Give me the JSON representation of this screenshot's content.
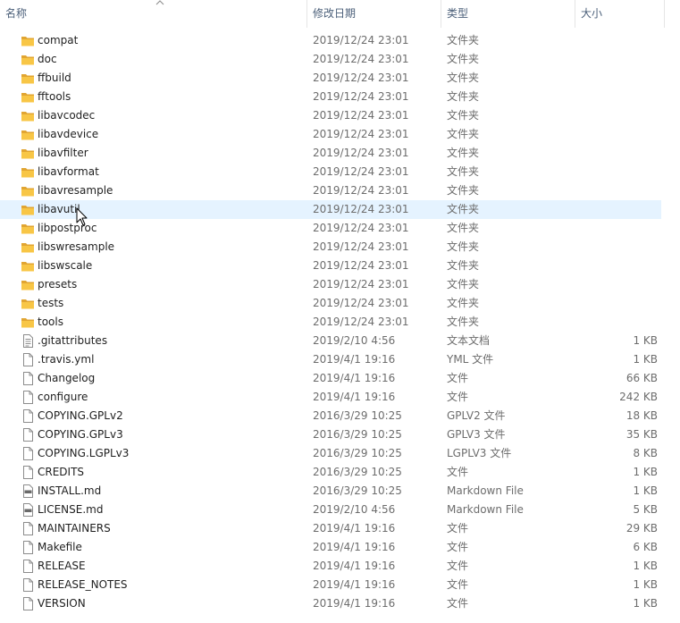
{
  "columns": {
    "name": "名称",
    "date": "修改日期",
    "type": "类型",
    "size": "大小"
  },
  "hover_row_index": 9,
  "icon_types": {
    "folder": "folder-icon",
    "file": "file-icon",
    "text": "text-document-icon",
    "markdown": "markdown-file-icon"
  },
  "colors": {
    "folder": "#f8c646",
    "folder_dark": "#e1a532",
    "hover": "#e5f3ff",
    "header_text": "#4c607a"
  },
  "files": [
    {
      "name": "compat",
      "date": "2019/12/24 23:01",
      "type": "文件夹",
      "size": "",
      "icon": "folder"
    },
    {
      "name": "doc",
      "date": "2019/12/24 23:01",
      "type": "文件夹",
      "size": "",
      "icon": "folder"
    },
    {
      "name": "ffbuild",
      "date": "2019/12/24 23:01",
      "type": "文件夹",
      "size": "",
      "icon": "folder"
    },
    {
      "name": "fftools",
      "date": "2019/12/24 23:01",
      "type": "文件夹",
      "size": "",
      "icon": "folder"
    },
    {
      "name": "libavcodec",
      "date": "2019/12/24 23:01",
      "type": "文件夹",
      "size": "",
      "icon": "folder"
    },
    {
      "name": "libavdevice",
      "date": "2019/12/24 23:01",
      "type": "文件夹",
      "size": "",
      "icon": "folder"
    },
    {
      "name": "libavfilter",
      "date": "2019/12/24 23:01",
      "type": "文件夹",
      "size": "",
      "icon": "folder"
    },
    {
      "name": "libavformat",
      "date": "2019/12/24 23:01",
      "type": "文件夹",
      "size": "",
      "icon": "folder"
    },
    {
      "name": "libavresample",
      "date": "2019/12/24 23:01",
      "type": "文件夹",
      "size": "",
      "icon": "folder"
    },
    {
      "name": "libavutil",
      "date": "2019/12/24 23:01",
      "type": "文件夹",
      "size": "",
      "icon": "folder"
    },
    {
      "name": "libpostproc",
      "date": "2019/12/24 23:01",
      "type": "文件夹",
      "size": "",
      "icon": "folder"
    },
    {
      "name": "libswresample",
      "date": "2019/12/24 23:01",
      "type": "文件夹",
      "size": "",
      "icon": "folder"
    },
    {
      "name": "libswscale",
      "date": "2019/12/24 23:01",
      "type": "文件夹",
      "size": "",
      "icon": "folder"
    },
    {
      "name": "presets",
      "date": "2019/12/24 23:01",
      "type": "文件夹",
      "size": "",
      "icon": "folder"
    },
    {
      "name": "tests",
      "date": "2019/12/24 23:01",
      "type": "文件夹",
      "size": "",
      "icon": "folder"
    },
    {
      "name": "tools",
      "date": "2019/12/24 23:01",
      "type": "文件夹",
      "size": "",
      "icon": "folder"
    },
    {
      "name": ".gitattributes",
      "date": "2019/2/10 4:56",
      "type": "文本文档",
      "size": "1 KB",
      "icon": "text"
    },
    {
      "name": ".travis.yml",
      "date": "2019/4/1 19:16",
      "type": "YML 文件",
      "size": "1 KB",
      "icon": "file"
    },
    {
      "name": "Changelog",
      "date": "2019/4/1 19:16",
      "type": "文件",
      "size": "66 KB",
      "icon": "file"
    },
    {
      "name": "configure",
      "date": "2019/4/1 19:16",
      "type": "文件",
      "size": "242 KB",
      "icon": "file"
    },
    {
      "name": "COPYING.GPLv2",
      "date": "2016/3/29 10:25",
      "type": "GPLV2 文件",
      "size": "18 KB",
      "icon": "file"
    },
    {
      "name": "COPYING.GPLv3",
      "date": "2016/3/29 10:25",
      "type": "GPLV3 文件",
      "size": "35 KB",
      "icon": "file"
    },
    {
      "name": "COPYING.LGPLv3",
      "date": "2016/3/29 10:25",
      "type": "LGPLV3 文件",
      "size": "8 KB",
      "icon": "file"
    },
    {
      "name": "CREDITS",
      "date": "2016/3/29 10:25",
      "type": "文件",
      "size": "1 KB",
      "icon": "file"
    },
    {
      "name": "INSTALL.md",
      "date": "2016/3/29 10:25",
      "type": "Markdown File",
      "size": "1 KB",
      "icon": "markdown"
    },
    {
      "name": "LICENSE.md",
      "date": "2019/2/10 4:56",
      "type": "Markdown File",
      "size": "5 KB",
      "icon": "markdown"
    },
    {
      "name": "MAINTAINERS",
      "date": "2019/4/1 19:16",
      "type": "文件",
      "size": "29 KB",
      "icon": "file"
    },
    {
      "name": "Makefile",
      "date": "2019/4/1 19:16",
      "type": "文件",
      "size": "6 KB",
      "icon": "file"
    },
    {
      "name": "RELEASE",
      "date": "2019/4/1 19:16",
      "type": "文件",
      "size": "1 KB",
      "icon": "file"
    },
    {
      "name": "RELEASE_NOTES",
      "date": "2019/4/1 19:16",
      "type": "文件",
      "size": "1 KB",
      "icon": "file"
    },
    {
      "name": "VERSION",
      "date": "2019/4/1 19:16",
      "type": "文件",
      "size": "1 KB",
      "icon": "file"
    }
  ]
}
